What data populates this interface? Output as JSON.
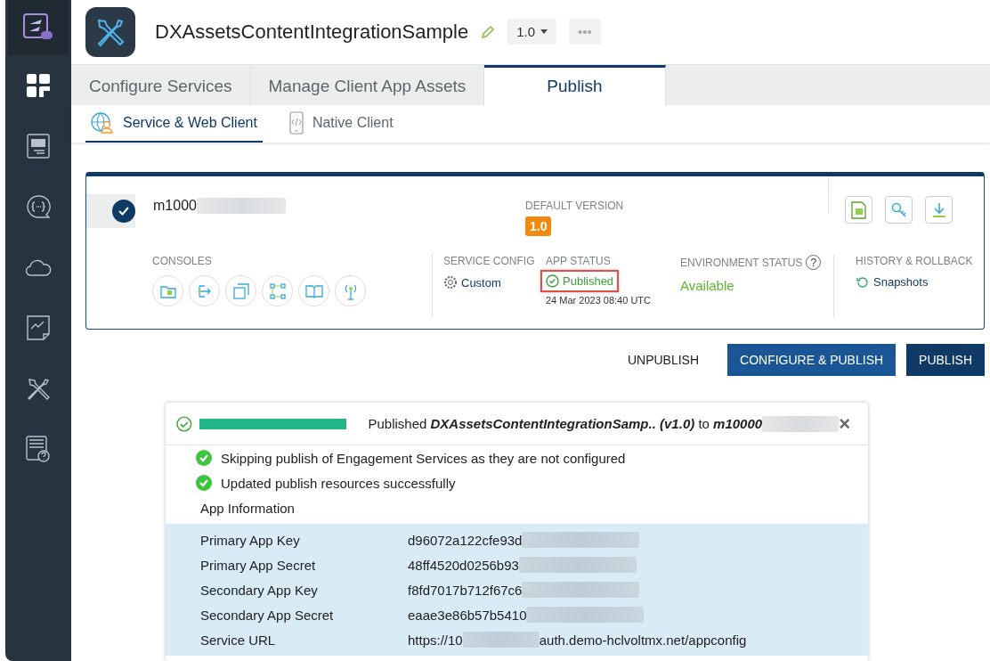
{
  "app": {
    "name": "DXAssetsContentIntegrationSample",
    "version": "1.0",
    "more": "•••"
  },
  "tabs": [
    {
      "label": "Configure Services",
      "selected": false
    },
    {
      "label": "Manage Client App Assets",
      "selected": false
    },
    {
      "label": "Publish",
      "selected": true
    }
  ],
  "subtabs": [
    {
      "label": "Service & Web Client",
      "kind": "web",
      "selected": true
    },
    {
      "label": "Native Client",
      "kind": "native",
      "selected": false
    }
  ],
  "environment": {
    "name": "m1000",
    "selected": true,
    "default_version_label": "DEFAULT VERSION",
    "default_version": "1.0",
    "consoles_label": "CONSOLES",
    "service_config_label": "SERVICE CONFIG",
    "service_config": "Custom",
    "app_status_label": "APP STATUS",
    "app_status": "Published",
    "published_date": "24 Mar 2023 08:40 UTC",
    "env_status_label": "ENVIRONMENT STATUS",
    "env_help": "?",
    "env_status": "Available",
    "history_label": "HISTORY & ROLLBACK",
    "history": "Snapshots"
  },
  "actions": [
    {
      "label": "UNPUBLISH",
      "kind": "link"
    },
    {
      "label": "CONFIGURE & PUBLISH",
      "kind": "secondary"
    },
    {
      "label": "PUBLISH",
      "kind": "primary"
    }
  ],
  "popup": {
    "level": 1,
    "title": "Published **DXAssetsContentIntegrationSamp.. (v1.0)** to **m10000**",
    "close": "×",
    "messages": [
      "Skipping publish of Engagement Services as they are not configured",
      "Updated publish resources successfully"
    ],
    "section": "App Information",
    "rows": [
      {
        "label": "Primary App Key",
        "value": "d96072a122cfe93d"
      },
      {
        "label": "Primary App Secret",
        "value": "48ff4520d0256b93"
      },
      {
        "label": "Secondary App Key",
        "value": "f8fd7017b712f67c6"
      },
      {
        "label": "Secondary App Secret",
        "value": "eaae3e86b57b5410"
      },
      {
        "label": "Service URL",
        "value": "https://10",
        "value_end": "auth.demo-hclvoltmx.net/appconfig"
      }
    ]
  }
}
